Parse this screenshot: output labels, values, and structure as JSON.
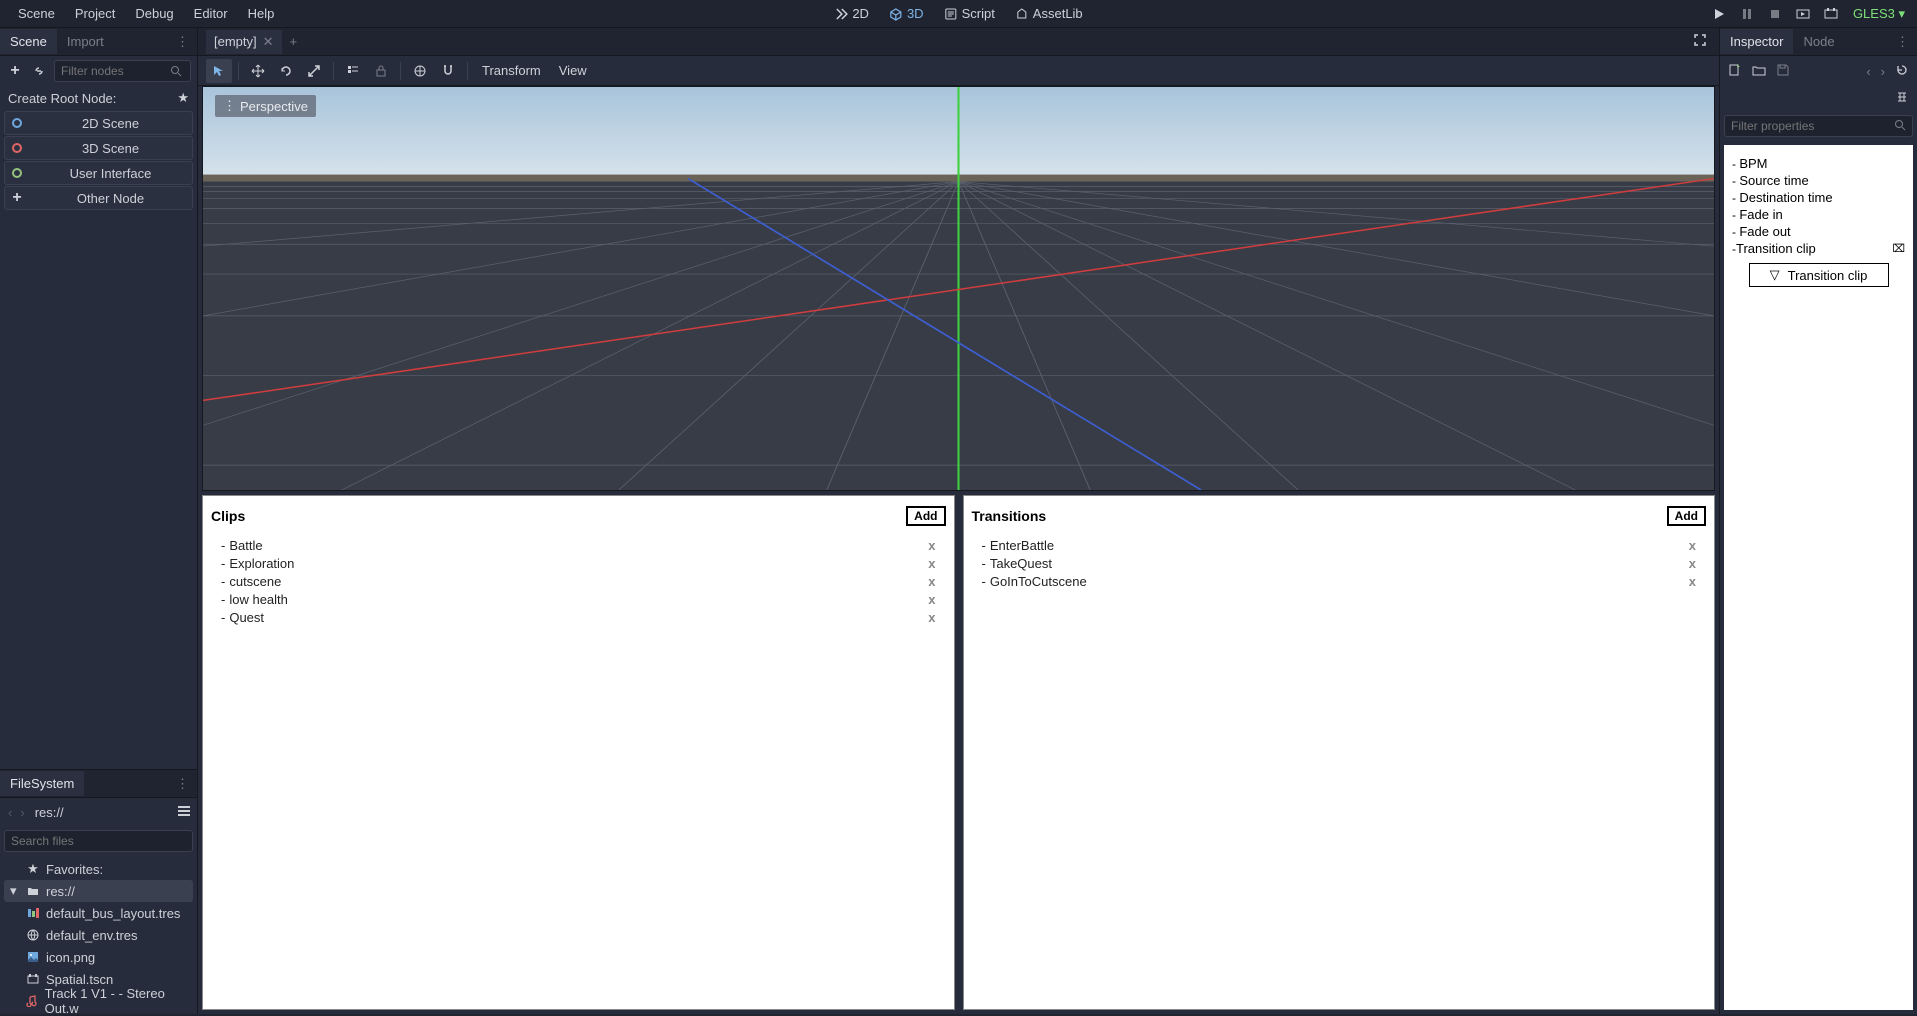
{
  "menubar": {
    "items": [
      "Scene",
      "Project",
      "Debug",
      "Editor",
      "Help"
    ],
    "modes": [
      {
        "label": "2D",
        "active": false
      },
      {
        "label": "3D",
        "active": true
      },
      {
        "label": "Script",
        "active": false
      },
      {
        "label": "AssetLib",
        "active": false
      }
    ],
    "renderer": "GLES3"
  },
  "scene_panel": {
    "tabs": [
      "Scene",
      "Import"
    ],
    "active_tab": 0,
    "filter_placeholder": "Filter nodes",
    "create_root_label": "Create Root Node:",
    "root_buttons": [
      {
        "label": "2D Scene",
        "icon": "circle-blue"
      },
      {
        "label": "3D Scene",
        "icon": "circle-red"
      },
      {
        "label": "User Interface",
        "icon": "circle-green"
      },
      {
        "label": "Other Node",
        "icon": "plus"
      }
    ]
  },
  "filesystem": {
    "title": "FileSystem",
    "path": "res://",
    "search_placeholder": "Search files",
    "favorites_label": "Favorites:",
    "root_label": "res://",
    "files": [
      {
        "name": "default_bus_layout.tres",
        "icon": "bus"
      },
      {
        "name": "default_env.tres",
        "icon": "env"
      },
      {
        "name": "icon.png",
        "icon": "img"
      },
      {
        "name": "Spatial.tscn",
        "icon": "scene"
      },
      {
        "name": "Track 1 V1 -  - Stereo Out.w",
        "icon": "audio"
      }
    ]
  },
  "scene_tabs": {
    "tabs": [
      {
        "label": "[empty]"
      }
    ]
  },
  "viewport_toolbar": {
    "menus": [
      "Transform",
      "View"
    ],
    "perspective_label": "Perspective"
  },
  "clips_panel": {
    "title": "Clips",
    "add_label": "Add",
    "items": [
      "Battle",
      "Exploration",
      "cutscene",
      "low health",
      "Quest"
    ]
  },
  "transitions_panel": {
    "title": "Transitions",
    "add_label": "Add",
    "items": [
      "EnterBattle",
      "TakeQuest",
      "GoInToCutscene"
    ]
  },
  "inspector": {
    "tabs": [
      "Inspector",
      "Node"
    ],
    "active_tab": 0,
    "filter_placeholder": "Filter properties",
    "props": [
      "BPM",
      "Source time",
      "Destination time",
      "Fade in",
      "Fade out"
    ],
    "transition_clip_label": "Transition clip",
    "dropdown_label": "Transition clip"
  }
}
